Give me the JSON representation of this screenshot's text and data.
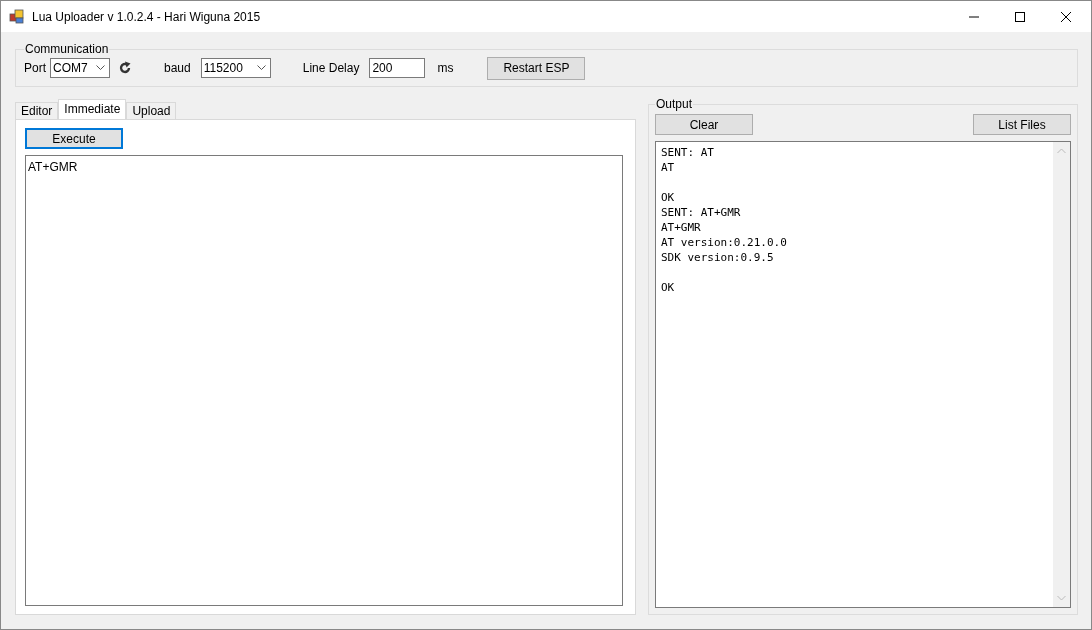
{
  "window": {
    "title": "Lua Uploader v 1.0.2.4 - Hari Wiguna 2015"
  },
  "communication": {
    "title": "Communication",
    "port_label": "Port",
    "port_value": "COM7",
    "baud_label": "baud",
    "baud_value": "115200",
    "line_delay_label": "Line Delay",
    "line_delay_value": "200",
    "line_delay_unit": "ms",
    "restart_button": "Restart ESP"
  },
  "tabs": [
    {
      "label": "Editor",
      "selected": false
    },
    {
      "label": "Immediate",
      "selected": true
    },
    {
      "label": "Upload",
      "selected": false
    }
  ],
  "immediate": {
    "execute_button": "Execute",
    "command": "AT+GMR"
  },
  "output": {
    "title": "Output",
    "clear_button": "Clear",
    "list_files_button": "List Files",
    "text": "SENT: AT\nAT\n\nOK\nSENT: AT+GMR\nAT+GMR\nAT version:0.21.0.0\nSDK version:0.9.5\n\nOK"
  }
}
